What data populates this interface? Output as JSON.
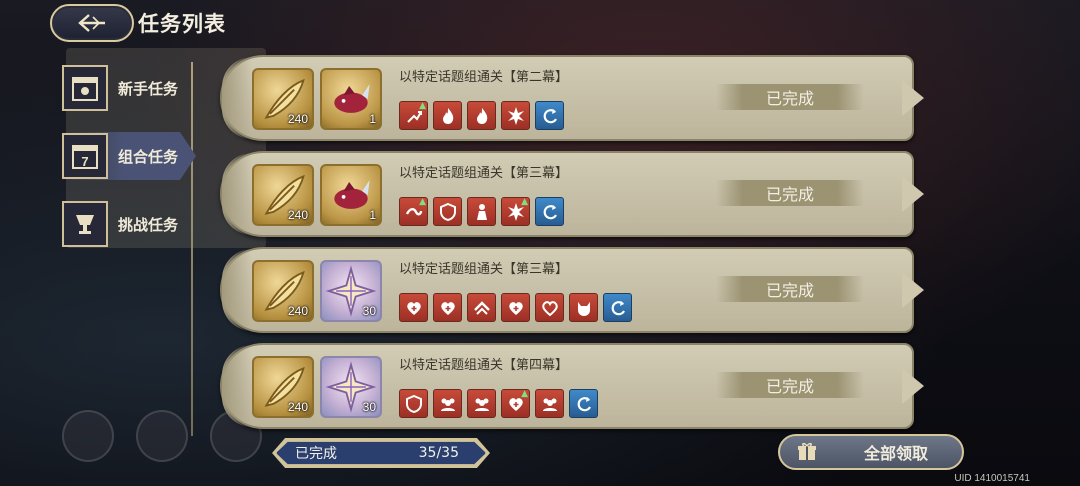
{
  "header": {
    "title": "任务列表"
  },
  "sidebar": {
    "items": [
      {
        "label": "新手任务",
        "icon": "calendar-sun-icon",
        "active": false
      },
      {
        "label": "组合任务",
        "icon": "calendar-seven-icon",
        "active": true
      },
      {
        "label": "挑战任务",
        "icon": "trophy-cup-icon",
        "active": false
      }
    ]
  },
  "tasks": [
    {
      "title": "以特定话题组通关【第二幕】",
      "rewards": [
        {
          "icon": "gold-quill-icon",
          "count": "240"
        },
        {
          "icon": "crimson-creature-icon",
          "count": "1"
        }
      ],
      "tags": [
        {
          "icon": "rising-arrow-icon",
          "color": "red",
          "plus": true
        },
        {
          "icon": "flame-icon",
          "color": "red"
        },
        {
          "icon": "flame-icon",
          "color": "red"
        },
        {
          "icon": "burst-icon",
          "color": "red"
        },
        {
          "icon": "swirl-icon",
          "color": "blue"
        }
      ],
      "status": "已完成"
    },
    {
      "title": "以特定话题组通关【第三幕】",
      "rewards": [
        {
          "icon": "gold-quill-icon",
          "count": "240"
        },
        {
          "icon": "crimson-creature-icon",
          "count": "1"
        }
      ],
      "tags": [
        {
          "icon": "wave-icon",
          "color": "red",
          "plus": true
        },
        {
          "icon": "shield-icon",
          "color": "red"
        },
        {
          "icon": "figure-icon",
          "color": "red"
        },
        {
          "icon": "burst-icon",
          "color": "red",
          "plus": true
        },
        {
          "icon": "swirl-icon",
          "color": "blue"
        }
      ],
      "status": "已完成"
    },
    {
      "title": "以特定话题组通关【第三幕】",
      "rewards": [
        {
          "icon": "gold-quill-icon",
          "count": "240"
        },
        {
          "icon": "crystal-star-icon",
          "count": "30"
        }
      ],
      "tags": [
        {
          "icon": "heart-plus-icon",
          "color": "red"
        },
        {
          "icon": "heart-plus-icon",
          "color": "red"
        },
        {
          "icon": "chevron-up-icon",
          "color": "red"
        },
        {
          "icon": "heart-plus-icon",
          "color": "red"
        },
        {
          "icon": "heart-ring-icon",
          "color": "red"
        },
        {
          "icon": "cat-icon",
          "color": "red"
        },
        {
          "icon": "swirl-icon",
          "color": "blue"
        }
      ],
      "status": "已完成"
    },
    {
      "title": "以特定话题组通关【第四幕】",
      "rewards": [
        {
          "icon": "gold-quill-icon",
          "count": "240"
        },
        {
          "icon": "crystal-star-icon",
          "count": "30"
        }
      ],
      "tags": [
        {
          "icon": "shield-icon",
          "color": "red"
        },
        {
          "icon": "group-icon",
          "color": "red"
        },
        {
          "icon": "group-icon",
          "color": "red"
        },
        {
          "icon": "heart-plus-icon",
          "color": "red",
          "plus": true
        },
        {
          "icon": "group-icon",
          "color": "red"
        },
        {
          "icon": "swirl-icon",
          "color": "blue"
        }
      ],
      "status": "已完成"
    }
  ],
  "footer": {
    "progress_label": "已完成",
    "progress_value": "35/35",
    "claim_all_label": "全部领取",
    "uid_text": "UID 1410015741"
  },
  "colors": {
    "card_bg": "#c9c2a9",
    "tag_red": "#b23f30",
    "tag_blue": "#3a7fbf",
    "progress_bg": "#2a3f6e"
  }
}
